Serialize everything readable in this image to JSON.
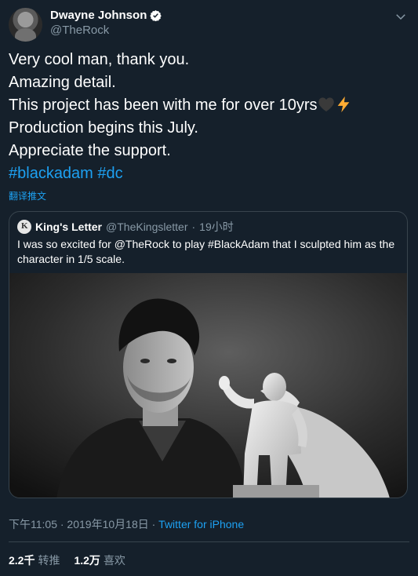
{
  "author": {
    "display_name": "Dwayne Johnson",
    "handle": "@TheRock",
    "verified": true
  },
  "tweet": {
    "lines": [
      "Very cool man, thank you.",
      "Amazing detail.",
      "This project has been with me for over 10yrs",
      "Production begins this July.",
      "Appreciate the support."
    ],
    "emojis": [
      "black-heart-icon",
      "high-voltage-icon"
    ],
    "hashtags": "#blackadam #dc",
    "translate_label": "翻译推文"
  },
  "quoted": {
    "display_name": "King's Letter",
    "handle": "@TheKingsletter",
    "separator": "·",
    "time": "19小时",
    "text": "I was so excited for @TheRock to play #BlackAdam that I sculpted him as the character in 1/5 scale."
  },
  "meta": {
    "time": "下午11:05 · 2019年10月18日 · ",
    "source": "Twitter for iPhone"
  },
  "stats": {
    "retweets_count": "2.2千",
    "retweets_label": "转推",
    "likes_count": "1.2万",
    "likes_label": "喜欢"
  },
  "colors": {
    "background": "#15202b",
    "link": "#1da1f2",
    "secondary_text": "#8899a6",
    "border": "#38444d"
  }
}
